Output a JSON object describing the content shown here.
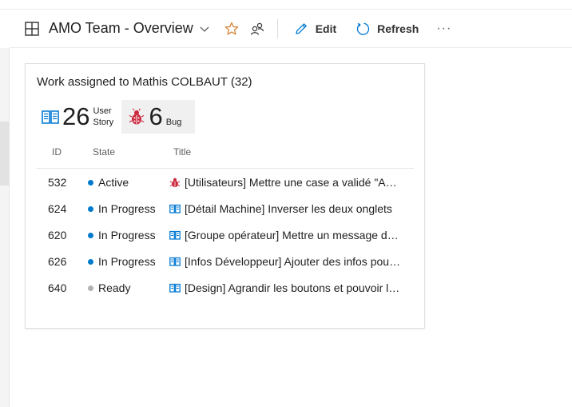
{
  "header": {
    "title": "AMO Team - Overview",
    "edit_label": "Edit",
    "refresh_label": "Refresh",
    "more_label": "···"
  },
  "widget": {
    "title": "Work assigned to Mathis COLBAUT (32)",
    "counts": {
      "user_story": {
        "count": "26",
        "label": "User Story"
      },
      "bug": {
        "count": "6",
        "label": "Bug"
      }
    },
    "columns": {
      "id": "ID",
      "state": "State",
      "title": "Title"
    },
    "rows": [
      {
        "id": "532",
        "state": "Active",
        "type": "bug",
        "title": "[Utilisateurs] Mettre une case a validé \"Actif\""
      },
      {
        "id": "624",
        "state": "In Progress",
        "type": "user-story",
        "title": "[Détail Machine] Inverser les deux onglets"
      },
      {
        "id": "620",
        "state": "In Progress",
        "type": "user-story",
        "title": "[Groupe opérateur] Mettre un message dans la liste"
      },
      {
        "id": "626",
        "state": "In Progress",
        "type": "user-story",
        "title": "[Infos Développeur] Ajouter des infos pour le support"
      },
      {
        "id": "640",
        "state": "Ready",
        "type": "user-story",
        "title": "[Design] Agrandir les boutons et pouvoir les déplacer"
      }
    ]
  },
  "colors": {
    "accent": "#0078d4",
    "star": "#d47a2b",
    "story_icon": "#0078d4",
    "bug_icon": "#cc293d",
    "state_active": "#007acc",
    "state_in_progress": "#007acc",
    "state_ready": "#b2b2b2"
  }
}
